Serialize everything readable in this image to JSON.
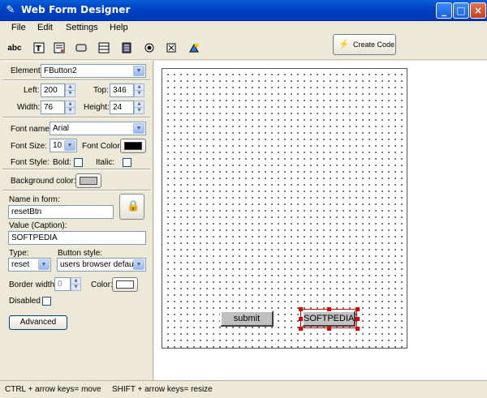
{
  "window": {
    "title": "Web Form Designer"
  },
  "menu": [
    "File",
    "Edit",
    "Settings",
    "Help"
  ],
  "toolbar": {
    "tools": [
      "abc-label-icon",
      "text-field-icon",
      "text-area-icon",
      "button-icon",
      "listbox-icon",
      "select-icon",
      "radio-icon",
      "checkbox-icon",
      "image-icon"
    ],
    "abc_label": "abc",
    "create_code": "Create Code"
  },
  "element": {
    "label": "Element:",
    "value": "FButton2"
  },
  "position": {
    "left_label": "Left:",
    "left": "200",
    "top_label": "Top:",
    "top": "346",
    "width_label": "Width:",
    "width": "76",
    "height_label": "Height:",
    "height": "24"
  },
  "font": {
    "name_label": "Font name:",
    "name": "Arial",
    "size_label": "Font Size:",
    "size": "10",
    "color_label": "Font Color:",
    "color": "#000000",
    "style_label": "Font Style:",
    "bold_label": "Bold:",
    "bold": false,
    "italic_label": "Italic:",
    "italic": false
  },
  "background": {
    "label": "Background color:",
    "color": "#c0c0c0"
  },
  "props": {
    "name_label": "Name in form:",
    "name": "resetBtn",
    "value_label": "Value (Caption):",
    "value": "SOFTPEDIA",
    "type_label": "Type:",
    "type": "reset",
    "style_label": "Button style:",
    "style": "users browser default",
    "border_label": "Border width:",
    "border": "0",
    "color_label": "Color:",
    "color": "#ffffff",
    "disabled_label": "Disabled",
    "disabled": false,
    "advanced": "Advanced"
  },
  "canvas": {
    "buttons": [
      {
        "caption": "submit",
        "selected": false
      },
      {
        "caption": "SOFTPEDIA",
        "selected": true
      }
    ]
  },
  "status": {
    "move": "CTRL + arrow keys= move",
    "resize": "SHIFT + arrow keys= resize"
  }
}
